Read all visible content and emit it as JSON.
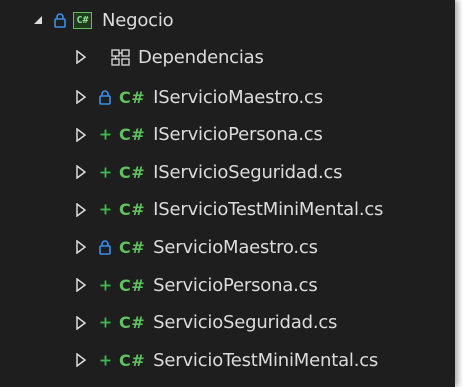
{
  "project": {
    "name": "Negocio",
    "icon_label": "C#",
    "status": "locked",
    "expander": "expanded-triangle"
  },
  "dependencies": {
    "label": "Dependencias",
    "icon": "dependencies-icon"
  },
  "cs_glyph": "C#",
  "files": [
    {
      "name": "IServicioMaestro.cs",
      "status": "locked"
    },
    {
      "name": "IServicioPersona.cs",
      "status": "added"
    },
    {
      "name": "IServicioSeguridad.cs",
      "status": "added"
    },
    {
      "name": "IServicioTestMiniMental.cs",
      "status": "added"
    },
    {
      "name": "ServicioMaestro.cs",
      "status": "locked"
    },
    {
      "name": "ServicioPersona.cs",
      "status": "added"
    },
    {
      "name": "ServicioSeguridad.cs",
      "status": "added"
    },
    {
      "name": "ServicioTestMiniMental.cs",
      "status": "added"
    }
  ],
  "colors": {
    "background": "#1e1e1e",
    "text": "#dcdcdc",
    "csharp_green": "#5ec35e",
    "lock_blue": "#3b8eea",
    "added_green": "#3fb950"
  }
}
